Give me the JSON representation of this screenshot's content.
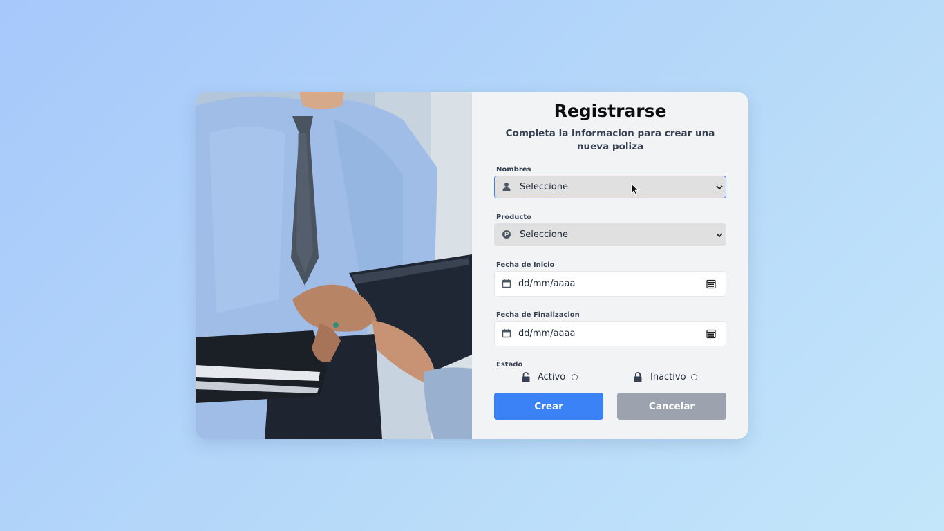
{
  "form": {
    "title": "Registrarse",
    "subtitle": "Completa la informacion para crear una nueva poliza",
    "fields": {
      "nombres": {
        "label": "Nombres",
        "value": "Seleccione",
        "icon": "user-icon"
      },
      "producto": {
        "label": "Producto",
        "value": "Seleccione",
        "icon": "p-circle-icon"
      },
      "fecha_inicio": {
        "label": "Fecha de Inicio",
        "placeholder": "dd/mm/aaaa",
        "icon": "calendar-icon"
      },
      "fecha_fin": {
        "label": "Fecha de Finalizacion",
        "placeholder": "dd/mm/aaaa",
        "icon": "calendar-icon"
      }
    },
    "estado": {
      "label": "Estado",
      "options": [
        {
          "label": "Activo",
          "icon": "unlock-icon",
          "selected": false
        },
        {
          "label": "Inactivo",
          "icon": "lock-icon",
          "selected": false
        }
      ]
    },
    "buttons": {
      "create": "Crear",
      "cancel": "Cancelar"
    }
  },
  "colors": {
    "primary": "#3b82f6",
    "secondary": "#9ca3af",
    "panel": "#f2f3f5",
    "background": "#a6c8fb"
  }
}
